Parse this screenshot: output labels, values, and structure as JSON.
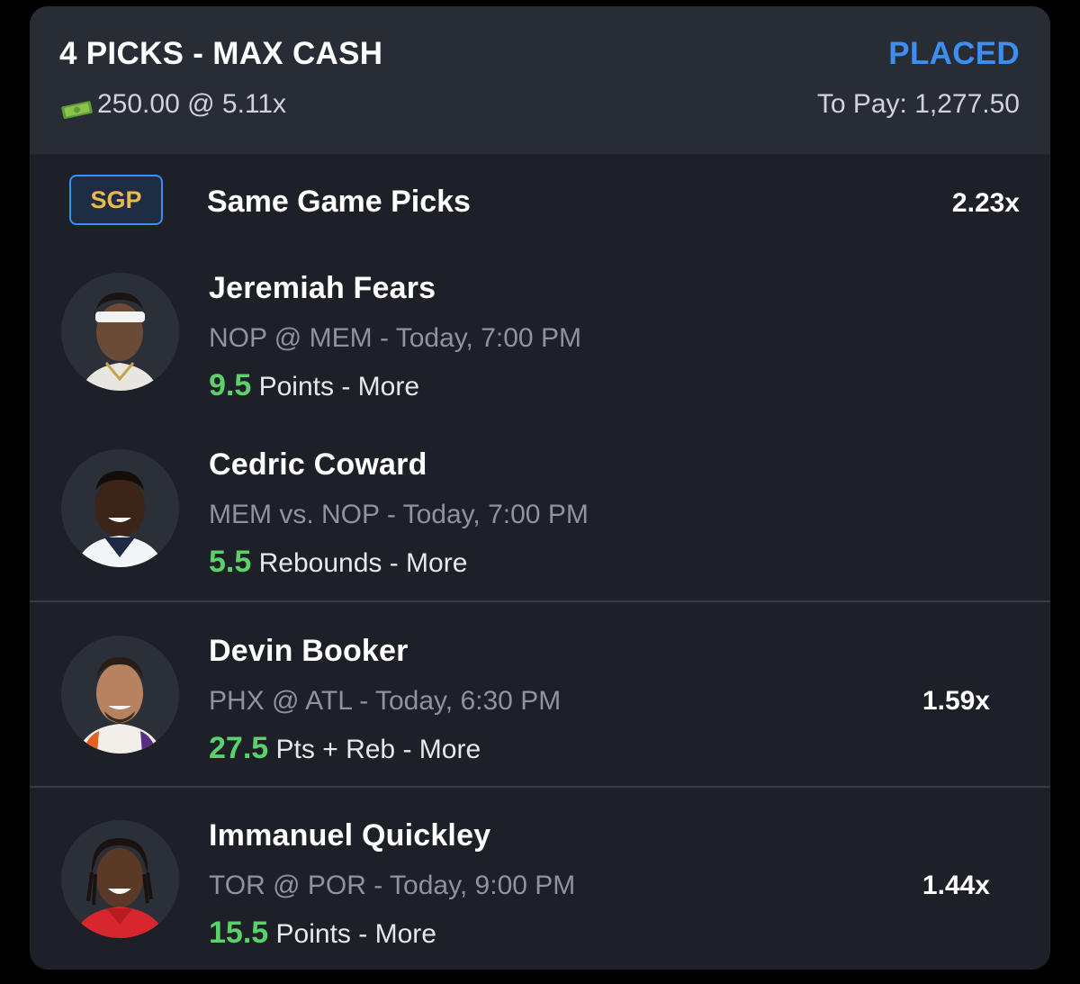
{
  "header": {
    "title": "4 PICKS - MAX CASH",
    "status": "PLACED",
    "stake": "250.00 @ 5.11x",
    "to_pay": "To Pay: 1,277.50",
    "stake_icon": "money-icon"
  },
  "sgp": {
    "badge": "SGP",
    "title": "Same Game Picks",
    "multiplier": "2.23x"
  },
  "picks": [
    {
      "name": "Jeremiah Fears",
      "matchup": "NOP @ MEM",
      "time": "- Today, 7:00 PM",
      "line": "9.5",
      "stat": "Points",
      "direction": "- More",
      "multiplier": ""
    },
    {
      "name": "Cedric Coward",
      "matchup": "MEM vs. NOP",
      "time": "- Today, 7:00 PM",
      "line": "5.5",
      "stat": "Rebounds",
      "direction": "- More",
      "multiplier": ""
    },
    {
      "name": "Devin Booker",
      "matchup": "PHX @ ATL",
      "time": "- Today, 6:30 PM",
      "line": "27.5",
      "stat": "Pts + Reb",
      "direction": "- More",
      "multiplier": "1.59x"
    },
    {
      "name": "Immanuel Quickley",
      "matchup": "TOR @ POR",
      "time": "- Today, 9:00 PM",
      "line": "15.5",
      "stat": "Points",
      "direction": "- More",
      "multiplier": "1.44x"
    }
  ],
  "colors": {
    "accent_blue": "#3d8ef0",
    "line_green": "#5bd16b",
    "sgp_gold": "#e9b949"
  }
}
